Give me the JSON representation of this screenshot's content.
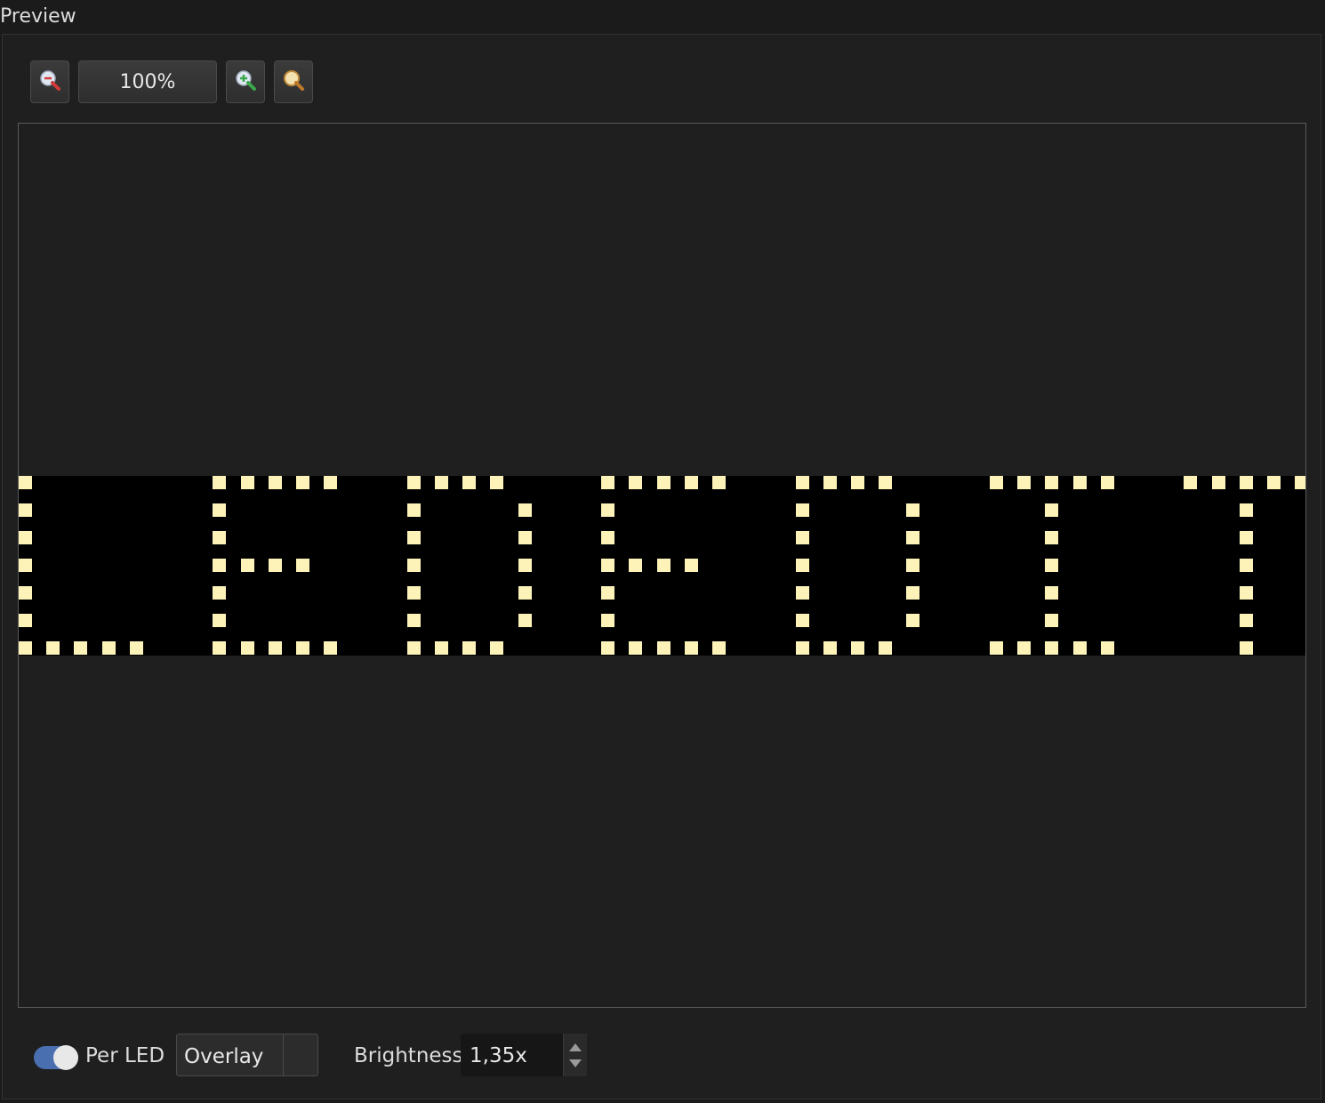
{
  "panel": {
    "title": "Preview"
  },
  "toolbar": {
    "zoom_out_icon": "zoom-out-icon",
    "zoom_value": "100%",
    "zoom_in_icon": "zoom-in-icon",
    "zoom_fit_icon": "zoom-fit-icon"
  },
  "preview": {
    "background_color": "#000000",
    "led_color": "#fdf3b8",
    "led_rows": 7,
    "led_cols": 47,
    "lit_leds": [
      [
        0,
        0
      ],
      [
        0,
        7
      ],
      [
        0,
        8
      ],
      [
        0,
        9
      ],
      [
        0,
        10
      ],
      [
        0,
        11
      ],
      [
        0,
        14
      ],
      [
        0,
        15
      ],
      [
        0,
        16
      ],
      [
        0,
        17
      ],
      [
        0,
        21
      ],
      [
        0,
        22
      ],
      [
        0,
        23
      ],
      [
        0,
        24
      ],
      [
        0,
        25
      ],
      [
        0,
        28
      ],
      [
        0,
        29
      ],
      [
        0,
        30
      ],
      [
        0,
        31
      ],
      [
        0,
        35
      ],
      [
        0,
        36
      ],
      [
        0,
        37
      ],
      [
        0,
        38
      ],
      [
        0,
        39
      ],
      [
        0,
        42
      ],
      [
        0,
        43
      ],
      [
        0,
        44
      ],
      [
        0,
        45
      ],
      [
        0,
        46
      ],
      [
        1,
        0
      ],
      [
        1,
        7
      ],
      [
        1,
        14
      ],
      [
        1,
        18
      ],
      [
        1,
        21
      ],
      [
        1,
        28
      ],
      [
        1,
        32
      ],
      [
        1,
        37
      ],
      [
        1,
        44
      ],
      [
        2,
        0
      ],
      [
        2,
        7
      ],
      [
        2,
        14
      ],
      [
        2,
        18
      ],
      [
        2,
        21
      ],
      [
        2,
        28
      ],
      [
        2,
        32
      ],
      [
        2,
        37
      ],
      [
        2,
        44
      ],
      [
        3,
        0
      ],
      [
        3,
        7
      ],
      [
        3,
        8
      ],
      [
        3,
        9
      ],
      [
        3,
        10
      ],
      [
        3,
        14
      ],
      [
        3,
        18
      ],
      [
        3,
        21
      ],
      [
        3,
        22
      ],
      [
        3,
        23
      ],
      [
        3,
        24
      ],
      [
        3,
        28
      ],
      [
        3,
        32
      ],
      [
        3,
        37
      ],
      [
        3,
        44
      ],
      [
        4,
        0
      ],
      [
        4,
        7
      ],
      [
        4,
        14
      ],
      [
        4,
        18
      ],
      [
        4,
        21
      ],
      [
        4,
        28
      ],
      [
        4,
        32
      ],
      [
        4,
        37
      ],
      [
        4,
        44
      ],
      [
        5,
        0
      ],
      [
        5,
        7
      ],
      [
        5,
        14
      ],
      [
        5,
        18
      ],
      [
        5,
        21
      ],
      [
        5,
        28
      ],
      [
        5,
        32
      ],
      [
        5,
        37
      ],
      [
        5,
        44
      ],
      [
        6,
        0
      ],
      [
        6,
        1
      ],
      [
        6,
        2
      ],
      [
        6,
        3
      ],
      [
        6,
        4
      ],
      [
        6,
        7
      ],
      [
        6,
        8
      ],
      [
        6,
        9
      ],
      [
        6,
        10
      ],
      [
        6,
        11
      ],
      [
        6,
        14
      ],
      [
        6,
        15
      ],
      [
        6,
        16
      ],
      [
        6,
        17
      ],
      [
        6,
        21
      ],
      [
        6,
        22
      ],
      [
        6,
        23
      ],
      [
        6,
        24
      ],
      [
        6,
        25
      ],
      [
        6,
        28
      ],
      [
        6,
        29
      ],
      [
        6,
        30
      ],
      [
        6,
        31
      ],
      [
        6,
        35
      ],
      [
        6,
        36
      ],
      [
        6,
        37
      ],
      [
        6,
        38
      ],
      [
        6,
        39
      ],
      [
        6,
        44
      ]
    ]
  },
  "controls": {
    "per_led_label": "Per LED",
    "per_led_enabled": true,
    "mode_value": "Overlay",
    "brightness_label": "Brightness",
    "brightness_value": "1,35x"
  },
  "colors": {
    "accent": "#4a6fb0",
    "panel_bg": "#1f1f1f"
  }
}
